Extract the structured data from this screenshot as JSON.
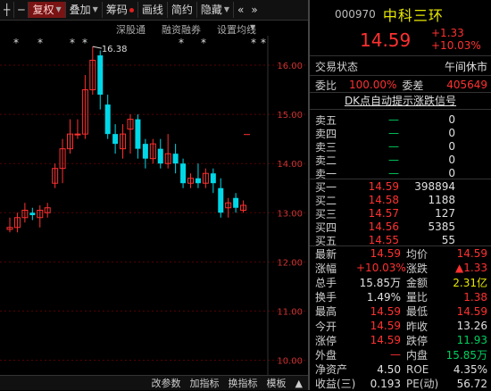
{
  "toolbar": {
    "items": [
      {
        "label": "┼"
      },
      {
        "label": "─"
      },
      {
        "label": "复权"
      },
      {
        "label": "叠加"
      },
      {
        "label": "筹码"
      },
      {
        "label": "画线"
      },
      {
        "label": "简约"
      },
      {
        "label": "隐藏"
      },
      {
        "label": "«"
      },
      {
        "label": "»"
      }
    ]
  },
  "sub_toolbar": {
    "items": [
      "深股通",
      "融资融券",
      "设置均线"
    ]
  },
  "chart": {
    "y_ticks": [
      "16.00",
      "15.00",
      "14.00",
      "13.00",
      "12.00",
      "11.00",
      "10.00"
    ],
    "high_label": "16.38",
    "stars": [
      "*",
      "*",
      "*",
      "*",
      "*",
      "*",
      "*",
      "*"
    ],
    "colors": {
      "up": "#ff3030",
      "down": "#00d8e8"
    }
  },
  "bottom_bar": {
    "items": [
      "改参数",
      "加指标",
      "换指标",
      "模板",
      "▲"
    ]
  },
  "quote": {
    "code": "000970",
    "name": "中科三环",
    "price": "14.59",
    "change": "+1.33",
    "change_pct": "+10.03%",
    "status_label": "交易状态",
    "status_value": "午间休市",
    "ratio_label": "委比",
    "ratio_value": "100.00%",
    "diff_label": "委差",
    "diff_value": "405649",
    "dk_link": "DK点自动提示涨跌信号",
    "asks": [
      {
        "label": "卖五",
        "price": "—",
        "vol": "0"
      },
      {
        "label": "卖四",
        "price": "—",
        "vol": "0"
      },
      {
        "label": "卖三",
        "price": "—",
        "vol": "0"
      },
      {
        "label": "卖二",
        "price": "—",
        "vol": "0"
      },
      {
        "label": "卖一",
        "price": "—",
        "vol": "0"
      }
    ],
    "bids": [
      {
        "label": "买一",
        "price": "14.59",
        "vol": "398894"
      },
      {
        "label": "买二",
        "price": "14.58",
        "vol": "1188"
      },
      {
        "label": "买三",
        "price": "14.57",
        "vol": "127"
      },
      {
        "label": "买四",
        "price": "14.56",
        "vol": "5385"
      },
      {
        "label": "买五",
        "price": "14.55",
        "vol": "55"
      }
    ],
    "stats": [
      {
        "l1": "最新",
        "v1": "14.59",
        "c1": "red",
        "l2": "均价",
        "v2": "14.59",
        "c2": "red"
      },
      {
        "l1": "涨幅",
        "v1": "+10.03%",
        "c1": "red",
        "l2": "涨跌",
        "v2": "▲1.33",
        "c2": "red"
      },
      {
        "l1": "总手",
        "v1": "15.85万",
        "c1": "white",
        "l2": "金额",
        "v2": "2.31亿",
        "c2": "yellow"
      },
      {
        "l1": "换手",
        "v1": "1.49%",
        "c1": "white",
        "l2": "量比",
        "v2": "1.38",
        "c2": "red"
      },
      {
        "l1": "最高",
        "v1": "14.59",
        "c1": "red",
        "l2": "最低",
        "v2": "14.59",
        "c2": "red"
      },
      {
        "l1": "今开",
        "v1": "14.59",
        "c1": "red",
        "l2": "昨收",
        "v2": "13.26",
        "c2": "white"
      },
      {
        "l1": "涨停",
        "v1": "14.59",
        "c1": "red",
        "l2": "跌停",
        "v2": "11.93",
        "c2": "green"
      },
      {
        "l1": "外盘",
        "v1": "—",
        "c1": "red",
        "l2": "内盘",
        "v2": "15.85万",
        "c2": "green"
      },
      {
        "l1": "净资产",
        "v1": "4.50",
        "c1": "white",
        "l2": "ROE",
        "v2": "4.35%",
        "c2": "white"
      },
      {
        "l1": "收益(三)",
        "v1": "0.193",
        "c1": "white",
        "l2": "PE(动)",
        "v2": "56.72",
        "c2": "white"
      }
    ]
  },
  "chart_data": {
    "type": "candlestick",
    "ylim": [
      9.7,
      16.6
    ],
    "y_ticks": [
      16,
      15,
      14,
      13,
      12,
      11,
      10
    ],
    "candles": [
      {
        "o": 12.66,
        "c": 12.7,
        "h": 12.9,
        "l": 12.6
      },
      {
        "o": 12.7,
        "c": 12.9,
        "h": 13.0,
        "l": 12.6
      },
      {
        "o": 12.9,
        "c": 13.05,
        "h": 13.2,
        "l": 12.8
      },
      {
        "o": 13.0,
        "c": 12.95,
        "h": 13.1,
        "l": 12.85
      },
      {
        "o": 12.9,
        "c": 13.05,
        "h": 13.15,
        "l": 12.7
      },
      {
        "o": 13.0,
        "c": 13.1,
        "h": 13.2,
        "l": 12.9
      },
      {
        "o": 13.6,
        "c": 13.9,
        "h": 14.0,
        "l": 13.5
      },
      {
        "o": 13.9,
        "c": 14.3,
        "h": 14.5,
        "l": 13.6
      },
      {
        "o": 14.3,
        "c": 14.6,
        "h": 14.9,
        "l": 14.2
      },
      {
        "o": 14.6,
        "c": 14.6,
        "h": 14.9,
        "l": 14.5
      },
      {
        "o": 14.6,
        "c": 15.5,
        "h": 15.8,
        "l": 14.5
      },
      {
        "o": 15.5,
        "c": 16.1,
        "h": 16.38,
        "l": 15.4
      },
      {
        "o": 16.2,
        "c": 15.4,
        "h": 16.3,
        "l": 15.1
      },
      {
        "o": 15.2,
        "c": 14.6,
        "h": 15.4,
        "l": 14.5
      },
      {
        "o": 14.6,
        "c": 14.4,
        "h": 14.8,
        "l": 14.2
      },
      {
        "o": 14.3,
        "c": 14.6,
        "h": 14.8,
        "l": 14.1
      },
      {
        "o": 14.7,
        "c": 14.9,
        "h": 15.0,
        "l": 14.2
      },
      {
        "o": 14.9,
        "c": 14.3,
        "h": 15.0,
        "l": 14.1
      },
      {
        "o": 14.4,
        "c": 14.1,
        "h": 14.5,
        "l": 13.9
      },
      {
        "o": 14.1,
        "c": 14.4,
        "h": 14.5,
        "l": 14.0
      },
      {
        "o": 14.3,
        "c": 14.0,
        "h": 14.5,
        "l": 13.9
      },
      {
        "o": 14.0,
        "c": 14.2,
        "h": 14.6,
        "l": 13.9
      },
      {
        "o": 14.2,
        "c": 14.0,
        "h": 14.4,
        "l": 13.8
      },
      {
        "o": 14.0,
        "c": 13.6,
        "h": 14.1,
        "l": 13.5
      },
      {
        "o": 13.6,
        "c": 13.7,
        "h": 13.8,
        "l": 13.5
      },
      {
        "o": 13.7,
        "c": 13.6,
        "h": 14.0,
        "l": 13.5
      },
      {
        "o": 13.6,
        "c": 13.8,
        "h": 13.9,
        "l": 13.5
      },
      {
        "o": 13.8,
        "c": 13.6,
        "h": 13.9,
        "l": 13.4
      },
      {
        "o": 13.5,
        "c": 13.0,
        "h": 13.7,
        "l": 12.9
      },
      {
        "o": 13.1,
        "c": 13.2,
        "h": 13.3,
        "l": 12.9
      },
      {
        "o": 13.3,
        "c": 13.1,
        "h": 13.4,
        "l": 13.0
      },
      {
        "o": 13.05,
        "c": 13.15,
        "h": 13.25,
        "l": 13.0
      }
    ],
    "markers": [
      {
        "value": 14.59,
        "label": ""
      }
    ]
  }
}
